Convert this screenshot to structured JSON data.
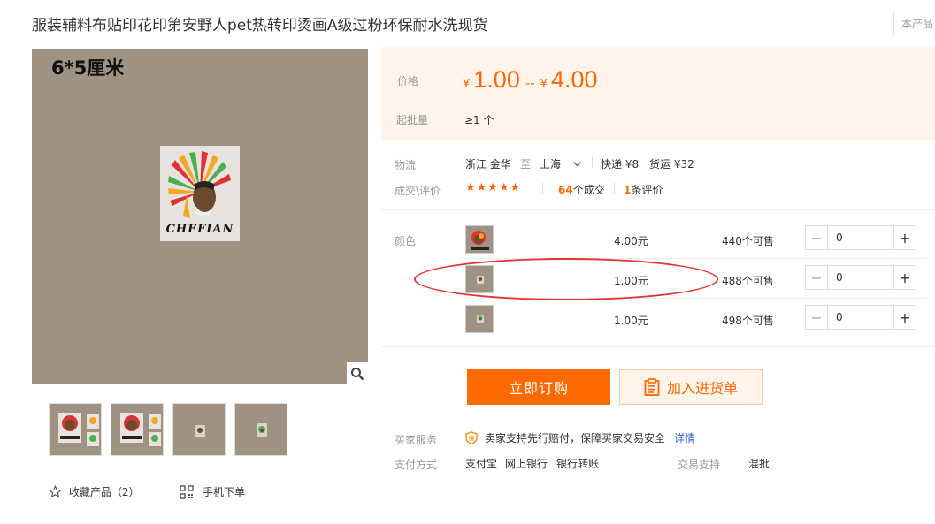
{
  "header": {
    "title": "服装辅料布贴印花印第安野人pet热转印烫画A级过粉环保耐水洗现货",
    "right_text": "本产品"
  },
  "gallery": {
    "main_size_label": "6*5厘米",
    "patch_caption": "CHEFIAN",
    "zoom_icon": "search-icon",
    "thumbnails": [
      {
        "label": "",
        "variant": "full"
      },
      {
        "label": "",
        "variant": "full"
      },
      {
        "label": "",
        "variant": "small"
      },
      {
        "label": "",
        "variant": "small"
      }
    ]
  },
  "actions": {
    "collect_label": "收藏产品（2）",
    "mobile_order_label": "手机下单"
  },
  "price_panel": {
    "price_label": "价格",
    "currency": "¥",
    "price_low": "1.00",
    "price_sep": "--",
    "price_high": "4.00",
    "moq_label": "起批量",
    "moq_value": "≥1 个",
    "accent_color": "#ff6600"
  },
  "logistics": {
    "label": "物流",
    "from": "浙江 金华",
    "to_word": "至",
    "to": "上海",
    "express": "快递 ¥8",
    "freight": "货运 ¥32"
  },
  "reviews": {
    "label": "成交\\评价",
    "stars": "★★★★★",
    "deal_count": "64",
    "deal_suffix": "个成交",
    "review_count": "1",
    "review_suffix": "条评价"
  },
  "sku": {
    "label": "颜色",
    "rows": [
      {
        "price": "4.00元",
        "stock": "440个可售",
        "qty": "0"
      },
      {
        "price": "1.00元",
        "stock": "488个可售",
        "qty": "0"
      },
      {
        "price": "1.00元",
        "stock": "498个可售",
        "qty": "0"
      }
    ]
  },
  "buttons": {
    "order": "立即订购",
    "cart": "加入进货单"
  },
  "service": {
    "buyer_label": "买家服务",
    "buyer_text": "卖家支持先行赔付，保障买家交易安全",
    "detail_link": "详情",
    "pay_label": "支付方式",
    "pay_methods": [
      "支付宝",
      "网上银行",
      "银行转账"
    ],
    "trade_label": "交易支持",
    "trade_value": "混批"
  }
}
